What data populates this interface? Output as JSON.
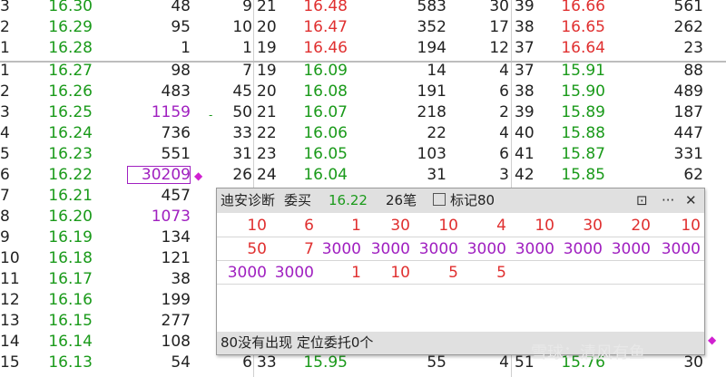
{
  "ask_rows": [
    {
      "idx": "3",
      "price": "16.30",
      "vol": "48",
      "cnt": "9",
      "idx2": "21",
      "price2": "16.48",
      "vol2": "583",
      "cnt2": "30",
      "idx3": "39",
      "price3": "16.66",
      "vol3": "561"
    },
    {
      "idx": "2",
      "price": "16.29",
      "vol": "95",
      "cnt": "10",
      "idx2": "20",
      "price2": "16.47",
      "vol2": "352",
      "cnt2": "17",
      "idx3": "38",
      "price3": "16.65",
      "vol3": "262"
    },
    {
      "idx": "1",
      "price": "16.28",
      "vol": "1",
      "cnt": "1",
      "idx2": "19",
      "price2": "16.46",
      "vol2": "194",
      "cnt2": "12",
      "idx3": "37",
      "price3": "16.64",
      "vol3": "23"
    }
  ],
  "bid_rows": [
    {
      "idx": "1",
      "price": "16.27",
      "vol": "98",
      "cnt": "7",
      "idx2": "19",
      "price2": "16.09",
      "vol2": "14",
      "cnt2": "4",
      "idx3": "37",
      "price3": "15.91",
      "vol3": "88"
    },
    {
      "idx": "2",
      "price": "16.26",
      "vol": "483",
      "cnt": "45",
      "idx2": "20",
      "price2": "16.08",
      "vol2": "191",
      "cnt2": "6",
      "idx3": "38",
      "price3": "15.90",
      "vol3": "489"
    },
    {
      "idx": "3",
      "price": "16.25",
      "vol": "1159",
      "cnt": "50",
      "idx2": "21",
      "price2": "16.07",
      "vol2": "218",
      "cnt2": "2",
      "idx3": "39",
      "price3": "15.89",
      "vol3": "187"
    },
    {
      "idx": "4",
      "price": "16.24",
      "vol": "736",
      "cnt": "33",
      "idx2": "22",
      "price2": "16.06",
      "vol2": "22",
      "cnt2": "4",
      "idx3": "40",
      "price3": "15.88",
      "vol3": "447"
    },
    {
      "idx": "5",
      "price": "16.23",
      "vol": "551",
      "cnt": "31",
      "idx2": "23",
      "price2": "16.05",
      "vol2": "103",
      "cnt2": "6",
      "idx3": "41",
      "price3": "15.87",
      "vol3": "331"
    },
    {
      "idx": "6",
      "price": "16.22",
      "vol": "30209",
      "cnt": "26",
      "idx2": "24",
      "price2": "16.04",
      "vol2": "31",
      "cnt2": "3",
      "idx3": "42",
      "price3": "15.85",
      "vol3": "62"
    },
    {
      "idx": "7",
      "price": "16.21",
      "vol": "457"
    },
    {
      "idx": "8",
      "price": "16.20",
      "vol": "1073"
    },
    {
      "idx": "9",
      "price": "16.19",
      "vol": "134"
    },
    {
      "idx": "10",
      "price": "16.18",
      "vol": "121"
    },
    {
      "idx": "11",
      "price": "16.17",
      "vol": "38"
    },
    {
      "idx": "12",
      "price": "16.16",
      "vol": "199"
    },
    {
      "idx": "13",
      "price": "16.15",
      "vol": "277"
    },
    {
      "idx": "14",
      "price": "16.14",
      "vol": "108"
    },
    {
      "idx": "15",
      "price": "16.13",
      "vol": "54",
      "cnt": "6",
      "idx2": "33",
      "price2": "15.95",
      "vol2": "55",
      "cnt2": "4",
      "idx3": "51",
      "price3": "15.76",
      "vol3": "30"
    }
  ],
  "popup": {
    "title": "迪安诊断",
    "side": "委买",
    "price": "16.22",
    "count": "26笔",
    "mark_label": "标记80",
    "rows": [
      [
        "10",
        "6",
        "1",
        "30",
        "10",
        "4",
        "10",
        "30",
        "20",
        "10"
      ],
      [
        "50",
        "7",
        "3000",
        "3000",
        "3000",
        "3000",
        "3000",
        "3000",
        "3000",
        "3000"
      ],
      [
        "3000",
        "3000",
        "1",
        "10",
        "5",
        "5"
      ]
    ],
    "status": "80没有出现   定位委托0个"
  },
  "watermark": "雪球：清风有鱼",
  "colors": {
    "up": "#e03030",
    "down": "#1a9a1a",
    "big": "#a020c0"
  }
}
